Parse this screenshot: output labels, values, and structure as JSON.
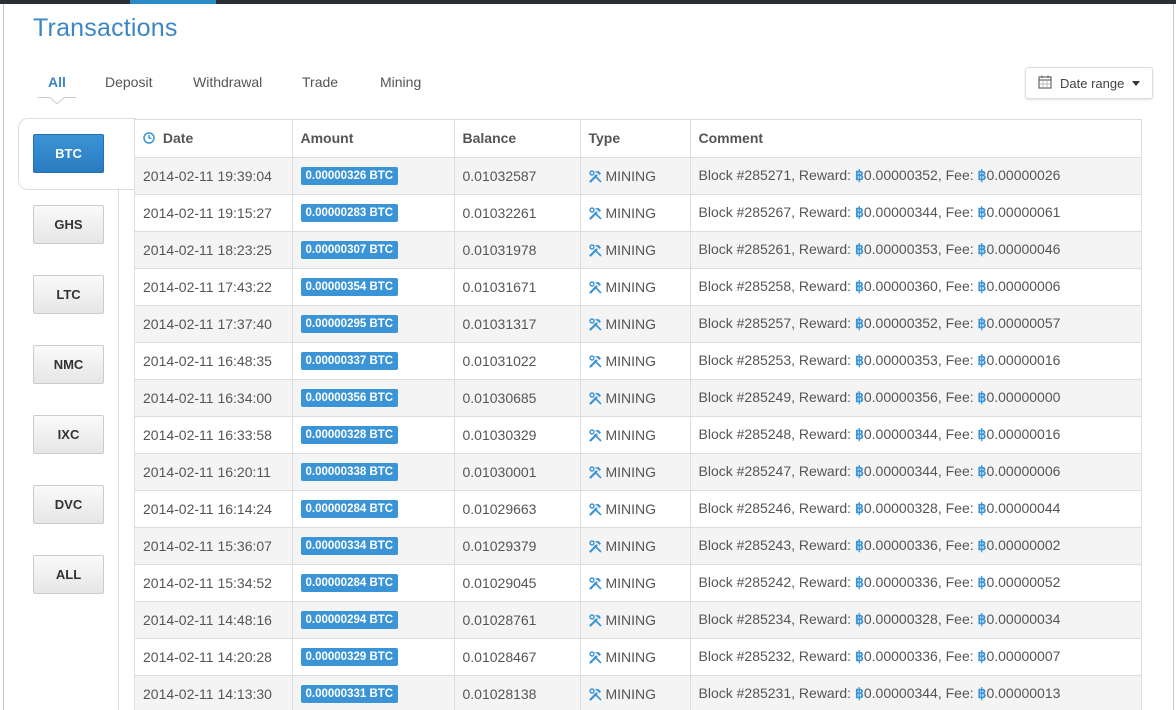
{
  "page": {
    "title": "Transactions"
  },
  "tabs": [
    {
      "label": "All",
      "active": true
    },
    {
      "label": "Deposit",
      "active": false
    },
    {
      "label": "Withdrawal",
      "active": false
    },
    {
      "label": "Trade",
      "active": false
    },
    {
      "label": "Mining",
      "active": false
    }
  ],
  "date_range": {
    "label": "Date range",
    "icon": "calendar-icon"
  },
  "currencies": [
    {
      "label": "BTC",
      "active": true
    },
    {
      "label": "GHS",
      "active": false
    },
    {
      "label": "LTC",
      "active": false
    },
    {
      "label": "NMC",
      "active": false
    },
    {
      "label": "IXC",
      "active": false
    },
    {
      "label": "DVC",
      "active": false
    },
    {
      "label": "ALL",
      "active": false
    }
  ],
  "table": {
    "headers": {
      "date": "Date",
      "amount": "Amount",
      "balance": "Balance",
      "type": "Type",
      "comment": "Comment"
    },
    "type_icon": "hammer-wrench-icon",
    "btc_symbol": "฿",
    "labels": {
      "reward": "Reward:",
      "fee": "Fee:"
    },
    "rows": [
      {
        "date": "2014-02-11 19:39:04",
        "amount": "0.00000326 BTC",
        "balance": "0.01032587",
        "type": "MINING",
        "block": "Block #285271,",
        "reward": "0.00000352,",
        "fee": "0.00000026"
      },
      {
        "date": "2014-02-11 19:15:27",
        "amount": "0.00000283 BTC",
        "balance": "0.01032261",
        "type": "MINING",
        "block": "Block #285267,",
        "reward": "0.00000344,",
        "fee": "0.00000061"
      },
      {
        "date": "2014-02-11 18:23:25",
        "amount": "0.00000307 BTC",
        "balance": "0.01031978",
        "type": "MINING",
        "block": "Block #285261,",
        "reward": "0.00000353,",
        "fee": "0.00000046"
      },
      {
        "date": "2014-02-11 17:43:22",
        "amount": "0.00000354 BTC",
        "balance": "0.01031671",
        "type": "MINING",
        "block": "Block #285258,",
        "reward": "0.00000360,",
        "fee": "0.00000006"
      },
      {
        "date": "2014-02-11 17:37:40",
        "amount": "0.00000295 BTC",
        "balance": "0.01031317",
        "type": "MINING",
        "block": "Block #285257,",
        "reward": "0.00000352,",
        "fee": "0.00000057"
      },
      {
        "date": "2014-02-11 16:48:35",
        "amount": "0.00000337 BTC",
        "balance": "0.01031022",
        "type": "MINING",
        "block": "Block #285253,",
        "reward": "0.00000353,",
        "fee": "0.00000016"
      },
      {
        "date": "2014-02-11 16:34:00",
        "amount": "0.00000356 BTC",
        "balance": "0.01030685",
        "type": "MINING",
        "block": "Block #285249,",
        "reward": "0.00000356,",
        "fee": "0.00000000"
      },
      {
        "date": "2014-02-11 16:33:58",
        "amount": "0.00000328 BTC",
        "balance": "0.01030329",
        "type": "MINING",
        "block": "Block #285248,",
        "reward": "0.00000344,",
        "fee": "0.00000016"
      },
      {
        "date": "2014-02-11 16:20:11",
        "amount": "0.00000338 BTC",
        "balance": "0.01030001",
        "type": "MINING",
        "block": "Block #285247,",
        "reward": "0.00000344,",
        "fee": "0.00000006"
      },
      {
        "date": "2014-02-11 16:14:24",
        "amount": "0.00000284 BTC",
        "balance": "0.01029663",
        "type": "MINING",
        "block": "Block #285246,",
        "reward": "0.00000328,",
        "fee": "0.00000044"
      },
      {
        "date": "2014-02-11 15:36:07",
        "amount": "0.00000334 BTC",
        "balance": "0.01029379",
        "type": "MINING",
        "block": "Block #285243,",
        "reward": "0.00000336,",
        "fee": "0.00000002"
      },
      {
        "date": "2014-02-11 15:34:52",
        "amount": "0.00000284 BTC",
        "balance": "0.01029045",
        "type": "MINING",
        "block": "Block #285242,",
        "reward": "0.00000336,",
        "fee": "0.00000052"
      },
      {
        "date": "2014-02-11 14:48:16",
        "amount": "0.00000294 BTC",
        "balance": "0.01028761",
        "type": "MINING",
        "block": "Block #285234,",
        "reward": "0.00000328,",
        "fee": "0.00000034"
      },
      {
        "date": "2014-02-11 14:20:28",
        "amount": "0.00000329 BTC",
        "balance": "0.01028467",
        "type": "MINING",
        "block": "Block #285232,",
        "reward": "0.00000336,",
        "fee": "0.00000007"
      },
      {
        "date": "2014-02-11 14:13:30",
        "amount": "0.00000331 BTC",
        "balance": "0.01028138",
        "type": "MINING",
        "block": "Block #285231,",
        "reward": "0.00000344,",
        "fee": "0.00000013"
      }
    ]
  },
  "colors": {
    "accent": "#3a94d6",
    "title": "#3d86c6"
  }
}
